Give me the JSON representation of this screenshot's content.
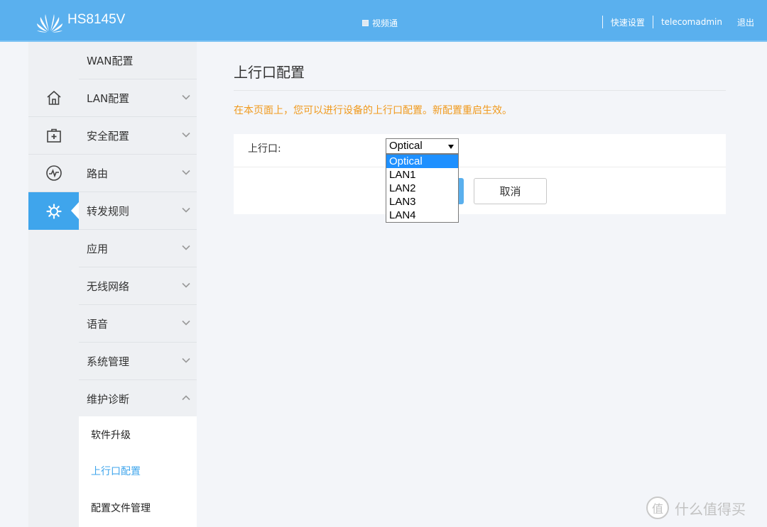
{
  "header": {
    "model": "HS8145V",
    "video_link": "视频通",
    "quick_setup": "快速设置",
    "username": "telecomadmin",
    "logout": "退出"
  },
  "rail": {
    "icons": [
      "home-icon",
      "first-aid-icon",
      "pulse-icon",
      "gear-icon"
    ],
    "active_index": 3
  },
  "menu": {
    "items": [
      {
        "label": "WAN配置"
      },
      {
        "label": "LAN配置"
      },
      {
        "label": "安全配置"
      },
      {
        "label": "路由"
      },
      {
        "label": "转发规则"
      },
      {
        "label": "应用"
      },
      {
        "label": "无线网络"
      },
      {
        "label": "语音"
      },
      {
        "label": "系统管理"
      },
      {
        "label": "维护诊断"
      }
    ],
    "submenu": [
      {
        "label": "软件升级"
      },
      {
        "label": "上行口配置"
      },
      {
        "label": "配置文件管理"
      }
    ]
  },
  "page": {
    "title": "上行口配置",
    "notice": "在本页面上，您可以进行设备的上行口配置。新配置重启生效。",
    "field_label": "上行口:",
    "select_value": "Optical",
    "options": [
      "Optical",
      "LAN1",
      "LAN2",
      "LAN3",
      "LAN4"
    ],
    "cancel_label": "取消"
  },
  "watermark": {
    "badge": "值",
    "text": "什么值得买"
  },
  "colors": {
    "header_bg": "#5ab0ee",
    "active_blue": "#3fa5ec",
    "notice_orange": "#f09a1e",
    "option_highlight": "#1e90ff"
  }
}
